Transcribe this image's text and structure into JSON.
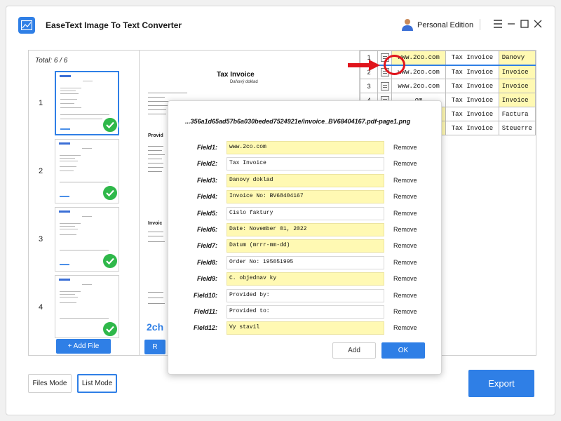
{
  "app": {
    "title": "EaseText Image To Text Converter",
    "edition": "Personal Edition"
  },
  "files": {
    "total_label": "Total: 6 / 6",
    "items": [
      {
        "number": "1",
        "selected": true,
        "status": "done"
      },
      {
        "number": "2",
        "selected": false,
        "status": "done"
      },
      {
        "number": "3",
        "selected": false,
        "status": "done"
      },
      {
        "number": "4",
        "selected": false,
        "status": "done"
      }
    ],
    "add_file_label": "+ Add File"
  },
  "document": {
    "title": "Tax Invoice",
    "subtitle": "Daňový doklad",
    "partial_heading": "2ch",
    "partial_button": "R",
    "bold_lines": [
      "Provid",
      "Invoic"
    ]
  },
  "table": {
    "rows": [
      {
        "num": "1",
        "c1": "www.2co.com",
        "c2": "Tax Invoice",
        "c3": "Danovy",
        "c1_yellow": true,
        "c3_yellow": true
      },
      {
        "num": "2",
        "c1": "www.2co.com",
        "c2": "Tax Invoice",
        "c3": "Invoice",
        "c1_yellow": false,
        "c3_yellow": true
      },
      {
        "num": "3",
        "c1": "www.2co.com",
        "c2": "Tax Invoice",
        "c3": "Invoice",
        "c1_yellow": false,
        "c3_yellow": true
      },
      {
        "num": "4",
        "c1": "om",
        "c2": "Tax Invoice",
        "c3": "Invoice",
        "c1_yellow": false,
        "c3_yellow": true
      },
      {
        "num": "5",
        "c1": "om",
        "c2": "Tax Invoice",
        "c3": "Factura",
        "c1_yellow": true,
        "c3_yellow": false
      },
      {
        "num": "6",
        "c1": "om",
        "c2": "Tax Invoice",
        "c3": "Steuerre",
        "c1_yellow": true,
        "c3_yellow": false
      }
    ]
  },
  "modes": {
    "files_mode": "Files Mode",
    "list_mode": "List Mode",
    "active": "list_mode"
  },
  "export_label": "Export",
  "dialog": {
    "path": "...356a1d65ad57b6a030beded7524921e/invoice_BV68404167.pdf-page1.png",
    "remove_label": "Remove",
    "add_label": "Add",
    "ok_label": "OK",
    "fields": [
      {
        "label": "Field1:",
        "value": "www.2co.com",
        "highlight": true
      },
      {
        "label": "Field2:",
        "value": "Tax Invoice",
        "highlight": false
      },
      {
        "label": "Field3:",
        "value": "Danovy doklad",
        "highlight": true
      },
      {
        "label": "Field4:",
        "value": "Invoice No: BV68404167",
        "highlight": true
      },
      {
        "label": "Field5:",
        "value": "Cislo faktury",
        "highlight": false
      },
      {
        "label": "Field6:",
        "value": "Date: November 01, 2022",
        "highlight": true
      },
      {
        "label": "Field7:",
        "value": "Datum (mrrr-mm-dd)",
        "highlight": true
      },
      {
        "label": "Field8:",
        "value": "Order No: 195051995",
        "highlight": false
      },
      {
        "label": "Field9:",
        "value": "C. objednav ky",
        "highlight": true
      },
      {
        "label": "Field10:",
        "value": "Provided by:",
        "highlight": false
      },
      {
        "label": "Field11:",
        "value": "Provided to:",
        "highlight": false
      },
      {
        "label": "Field12:",
        "value": "Vy stavil",
        "highlight": true
      }
    ]
  },
  "colors": {
    "accent": "#2f7fe6",
    "highlight": "#fff9b3",
    "success": "#2fb84a",
    "callout": "#e0141c"
  }
}
